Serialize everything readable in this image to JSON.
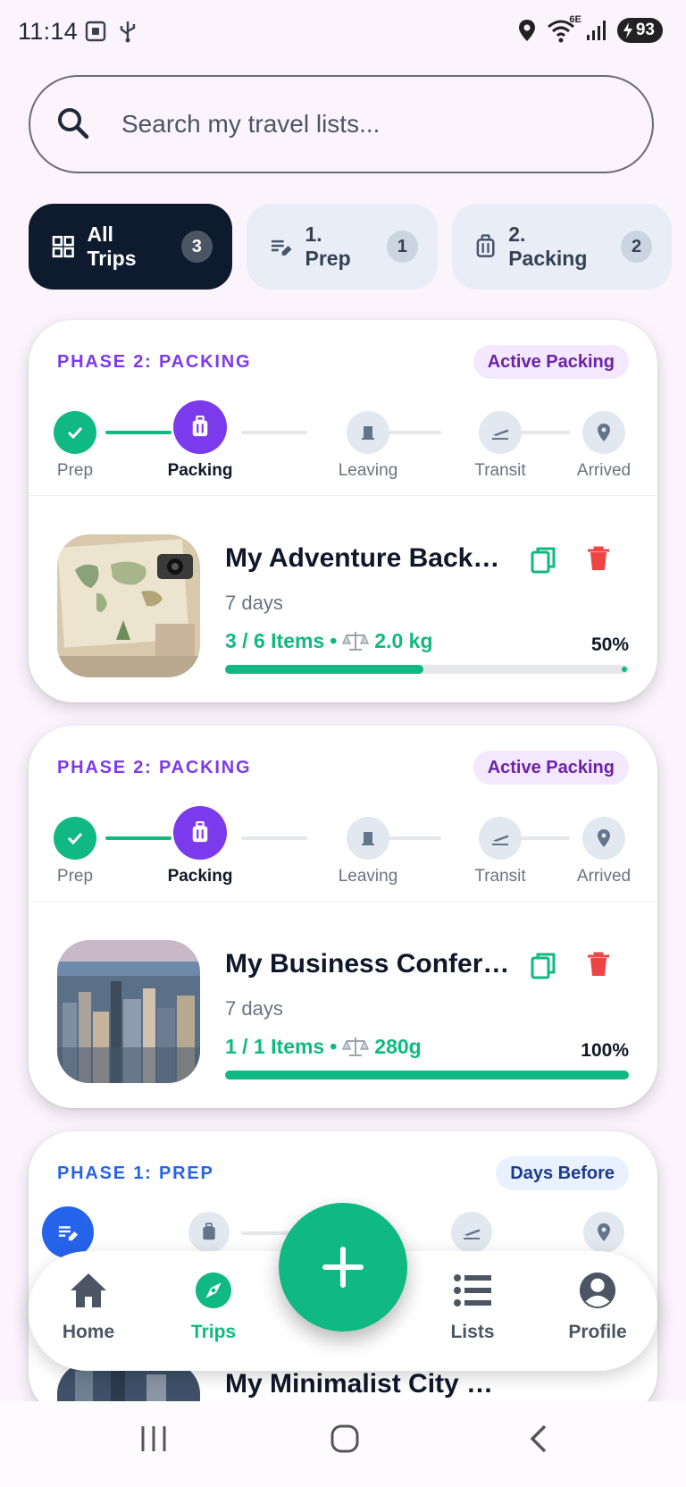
{
  "status_bar": {
    "time": "11:14",
    "network": "6E",
    "battery": "93"
  },
  "search": {
    "placeholder": "Search my travel lists..."
  },
  "filters": [
    {
      "label": "All Trips",
      "count": "3",
      "icon": "grid-icon",
      "active": true
    },
    {
      "label": "1. Prep",
      "count": "1",
      "icon": "edit-list-icon",
      "active": false
    },
    {
      "label": "2. Packing",
      "count": "2",
      "icon": "luggage-icon",
      "active": false
    }
  ],
  "steps": [
    "Prep",
    "Packing",
    "Leaving",
    "Transit",
    "Arrived"
  ],
  "trips": [
    {
      "phase": "PHASE 2: PACKING",
      "badge": "Active Packing",
      "title": "My Adventure Backpa...",
      "duration": "7 days",
      "items": "3 / 6 Items",
      "weight": "2.0 kg",
      "percent_label": "50%",
      "progress": 0.5,
      "thumbnail": "world-map-photo"
    },
    {
      "phase": "PHASE 2: PACKING",
      "badge": "Active Packing",
      "title": "My Business Confere...",
      "duration": "7 days",
      "items": "1 / 1 Items",
      "weight": "280g",
      "percent_label": "100%",
      "progress": 1.0,
      "thumbnail": "city-skyline-photo"
    },
    {
      "phase": "PHASE 1: PREP",
      "badge": "Days Before",
      "title": "My Minimalist City Br..."
    }
  ],
  "bottom_nav": [
    {
      "label": "Home",
      "icon": "home-icon"
    },
    {
      "label": "Trips",
      "icon": "compass-icon",
      "active": true
    },
    {
      "label": "Lists",
      "icon": "list-icon"
    },
    {
      "label": "Profile",
      "icon": "profile-icon"
    }
  ],
  "fab_icon": "plus-icon",
  "colors": {
    "accent_green": "#10b981",
    "phase_purple": "#7c3aed",
    "phase_blue": "#2563eb",
    "delete_red": "#ef4444",
    "dark_chip": "#0e1a2e"
  }
}
